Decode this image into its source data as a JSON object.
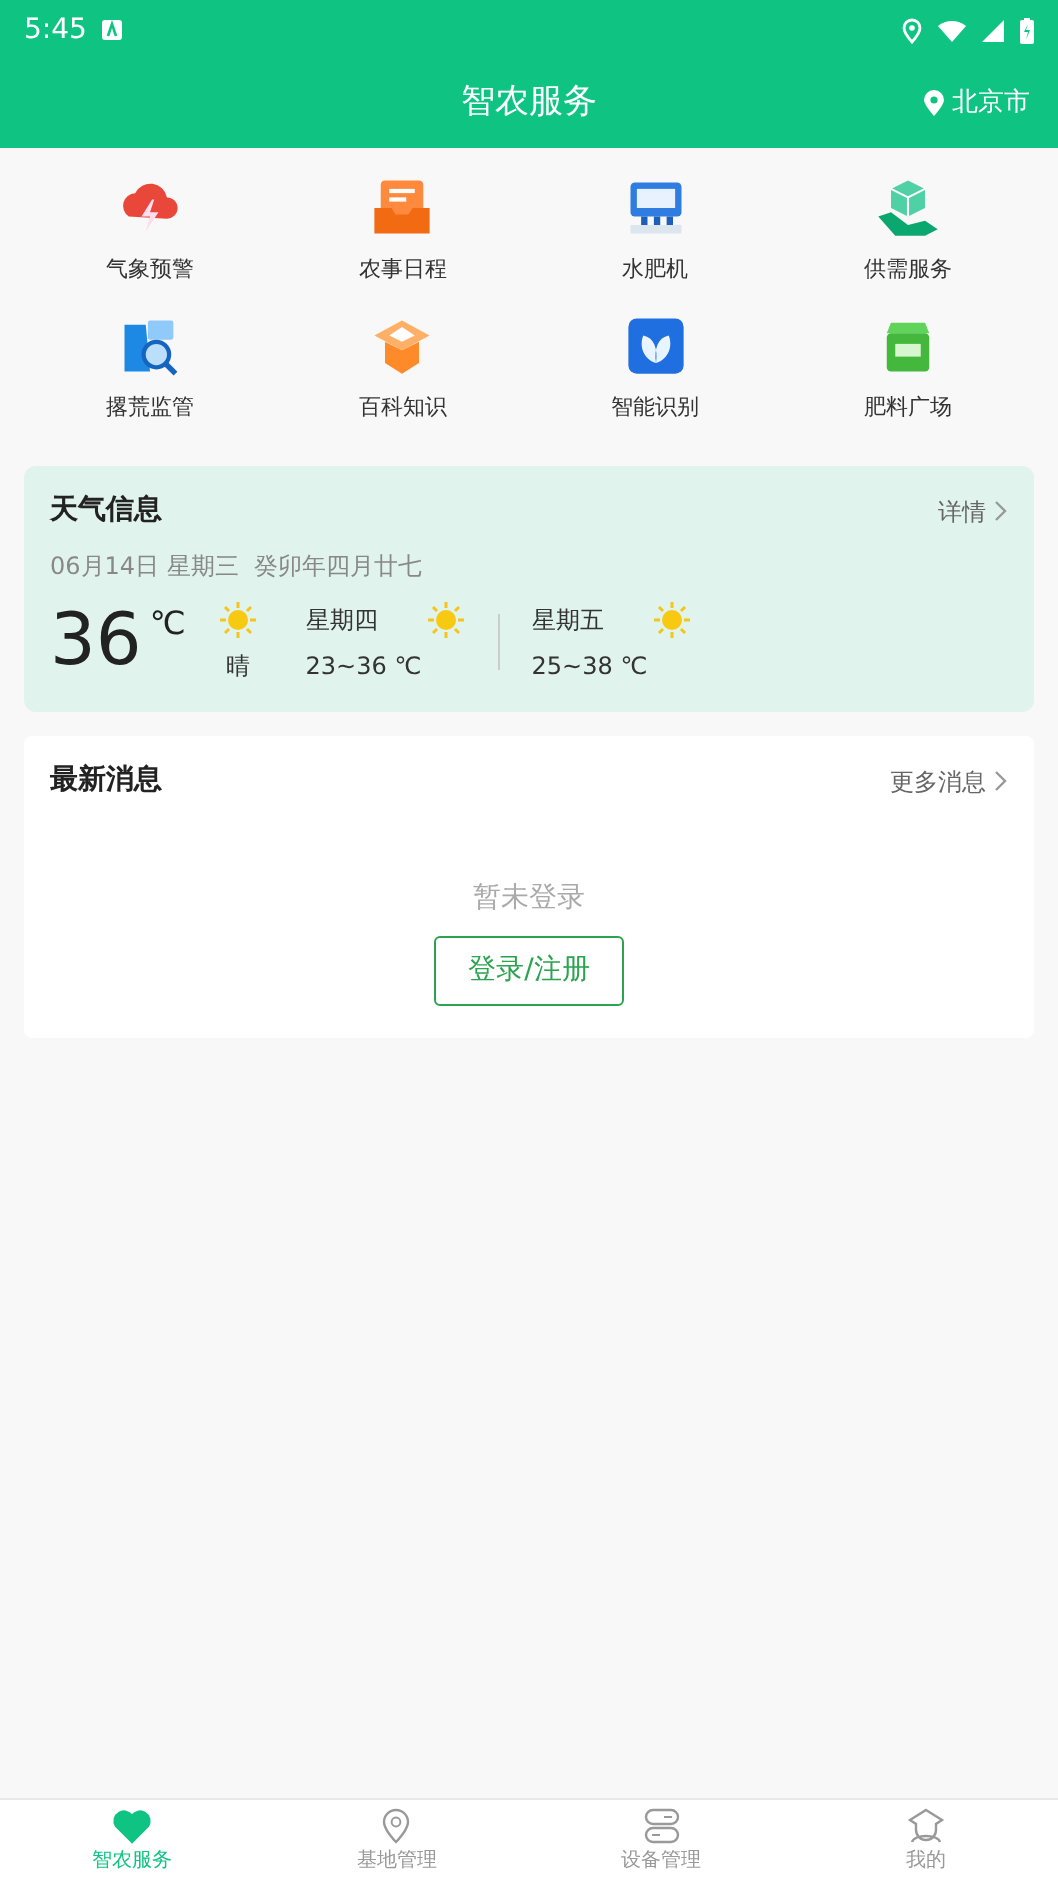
{
  "status_bar": {
    "time": "5:45"
  },
  "header": {
    "title": "智农服务",
    "location": "北京市"
  },
  "services": [
    {
      "label": "气象预警"
    },
    {
      "label": "农事日程"
    },
    {
      "label": "水肥机"
    },
    {
      "label": "供需服务"
    },
    {
      "label": "撂荒监管"
    },
    {
      "label": "百科知识"
    },
    {
      "label": "智能识别"
    },
    {
      "label": "肥料广场"
    }
  ],
  "weather": {
    "title": "天气信息",
    "more": "详情",
    "date": "06月14日 星期三  癸卯年四月廿七",
    "temperature": "36",
    "unit": "℃",
    "condition": "晴",
    "forecast": [
      {
        "day": "星期四",
        "range": "23~36 ℃"
      },
      {
        "day": "星期五",
        "range": "25~38 ℃"
      }
    ]
  },
  "news": {
    "title": "最新消息",
    "more": "更多消息",
    "empty_text": "暂未登录",
    "login_button": "登录/注册"
  },
  "tabs": [
    {
      "label": "智农服务",
      "selected": true
    },
    {
      "label": "基地管理",
      "selected": false
    },
    {
      "label": "设备管理",
      "selected": false
    },
    {
      "label": "我的",
      "selected": false
    }
  ]
}
